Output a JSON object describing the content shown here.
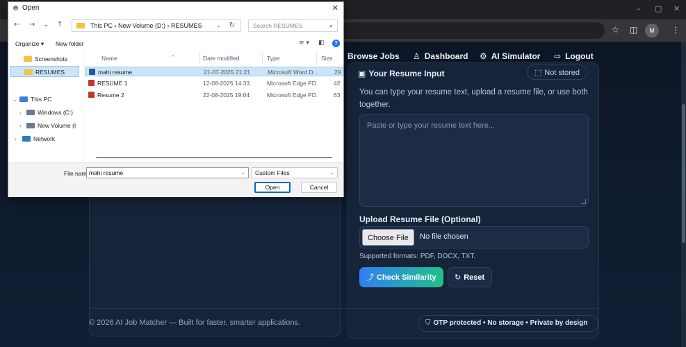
{
  "browser": {
    "window_controls": {
      "minimize": "–",
      "maximize": "▢",
      "close": "✕"
    },
    "toolbar_icons": {
      "bookmark": "☆",
      "extensions": "◫",
      "profile_initial": "M",
      "menu": "⋮"
    }
  },
  "nav": {
    "browse_jobs": "Browse Jobs",
    "dashboard": "Dashboard",
    "ai_simulator": "AI Simulator",
    "logout": "Logout",
    "icons": {
      "dashboard": "♙",
      "ai_simulator": "⚙",
      "logout": "⇨"
    }
  },
  "resume_card": {
    "heading": "Your Resume Input",
    "badge": "Not stored",
    "description": "You can type your resume text, upload a resume file, or use both together.",
    "textarea_placeholder": "Paste or type your resume text here...",
    "upload_label": "Upload Resume File (Optional)",
    "choose_file_label": "Choose File",
    "file_status": "No file chosen",
    "supported_formats": "Supported formats: PDF, DOCX, TXT.",
    "check_button": "Check Similarity",
    "reset_button": "Reset",
    "icons": {
      "check": "⤴",
      "reset": "↻",
      "heading": "▣",
      "badge": "⬚"
    }
  },
  "footer": {
    "copyright": "© 2026 AI Job Matcher — Built for faster, smarter applications.",
    "privacy": "OTP protected • No storage • Private by design",
    "privacy_icon": "⛉"
  },
  "dialog": {
    "title": "Open",
    "close_icon": "✕",
    "nav_icons": {
      "back": "←",
      "forward": "→",
      "recent": "⌄",
      "up": "↑"
    },
    "path": "This PC  ›  New Volume (D:)  ›  RESUMES",
    "path_dropdown": "⌄",
    "refresh": "↻",
    "search_placeholder": "Search RESUMES",
    "search_icon": "⌕",
    "organize": "Organize ▾",
    "new_folder": "New folder",
    "view_icons": {
      "view": "≡  ▾",
      "preview": "◧",
      "help": "?"
    },
    "tree": [
      {
        "label": "Screenshots",
        "selected": false
      },
      {
        "label": "RESUMES",
        "selected": true
      },
      {
        "label": "This PC",
        "selected": false
      },
      {
        "label": "Windows (C:)",
        "selected": false
      },
      {
        "label": "New Volume (I",
        "selected": false
      },
      {
        "label": "Network",
        "selected": false
      }
    ],
    "tree_chevrons": {
      "this_pc": "⌄",
      "windows": "›",
      "new_volume": "›",
      "network": "›"
    },
    "columns": {
      "name": "Name",
      "date": "Date modified",
      "type": "Type",
      "size": "Size"
    },
    "sort_indicator": "^",
    "files": [
      {
        "name": "mahi resume",
        "date": "21-07-2025 21:21",
        "type": "Microsoft Word D...",
        "size": "29",
        "icon": "word",
        "selected": true
      },
      {
        "name": "RESUME 1",
        "date": "12-08-2025 14:33",
        "type": "Microsoft Edge PD...",
        "size": "42",
        "icon": "pdf",
        "selected": false
      },
      {
        "name": "Resume 2",
        "date": "22-08-2025 19:04",
        "type": "Microsoft Edge PD...",
        "size": "63",
        "icon": "pdf",
        "selected": false
      }
    ],
    "file_name_label": "File name:",
    "file_name_value": "mahi resume",
    "file_name_dropdown": "⌄",
    "file_type": "Custom Files",
    "file_type_dropdown": "⌄",
    "open_button": "Open",
    "cancel_button": "Cancel"
  }
}
